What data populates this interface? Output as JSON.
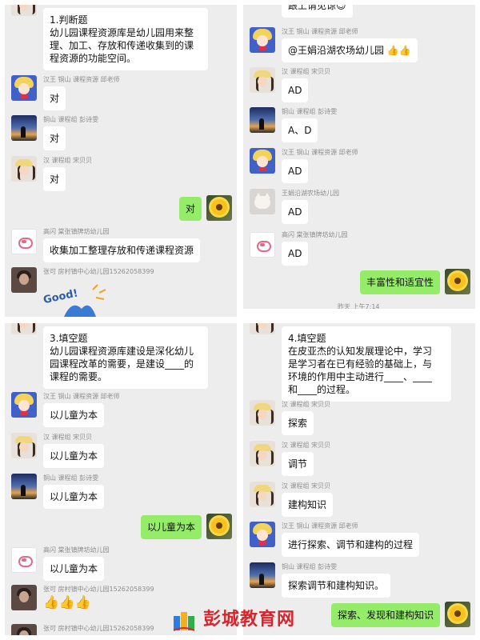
{
  "panel1": {
    "question": "1.判断题\n幼儿园课程资源库是幼儿园用来整\n理、加工、存放和传递收集到的课\n程资源的功能空间。",
    "messages": [
      {
        "sender": "汉王  铜山  课程资源  邱老师",
        "text": "对",
        "avatar": "sailor-avatar"
      },
      {
        "sender": "铜山  课程组  彭诗雯",
        "text": "对",
        "avatar": "sunset-avatar"
      },
      {
        "sender": "汉  课程组  宋贝贝",
        "text": "对",
        "avatar": "girl-avatar"
      },
      {
        "sender": "",
        "text": "对",
        "avatar": "sunflower-avatar",
        "self": true
      },
      {
        "sender": "高闪  棠张镇牌坊幼儿园",
        "text": "收集加工整理存放和传递课程资源",
        "avatar": "pig-avatar"
      },
      {
        "sender": "张可  房村镇中心幼儿园15262058399",
        "text": "",
        "avatar": "dark-avatar"
      }
    ],
    "sticker_text": "Good!"
  },
  "panel2": {
    "top_text": "跟上请见谅😉",
    "messages": [
      {
        "sender": "汉王  铜山  课程资源  邱老师",
        "text": "@王娟沿湖农场幼儿园 👍👍"
      },
      {
        "sender": "汉  课程组  宋贝贝",
        "text": "AD"
      },
      {
        "sender": "铜山  课程组  彭诗雯",
        "text": "A、D"
      },
      {
        "sender": "汉王  铜山  课程资源  邱老师",
        "text": "AD"
      },
      {
        "sender": "王娟沿湖农场幼儿园",
        "text": "AD"
      },
      {
        "sender": "高闪  棠张镇牌坊幼儿园",
        "text": "AD"
      },
      {
        "sender": "",
        "text": "丰富性和适宜性",
        "self": true
      }
    ],
    "timestamp": "昨天 上午7:14"
  },
  "panel3": {
    "question": "3.填空题\n幼儿园课程资源库建设是深化幼儿\n园课程改革的需要，是建设____的\n课程的需要。",
    "messages": [
      {
        "sender": "汉王  铜山  课程资源  邱老师",
        "text": "以儿童为本"
      },
      {
        "sender": "汉  课程组  宋贝贝",
        "text": "以儿童为本"
      },
      {
        "sender": "铜山  课程组  彭诗雯",
        "text": "以儿童为本"
      },
      {
        "sender": "",
        "text": "以儿童为本",
        "self": true
      },
      {
        "sender": "高闪  棠张镇牌坊幼儿园",
        "text": "以儿童为本"
      },
      {
        "sender": "张可  房村镇中心幼儿园15262058399",
        "text": "👍👍👍"
      },
      {
        "sender": "张可  房村镇中心幼儿园15262058399",
        "text": ""
      }
    ]
  },
  "panel4": {
    "question": "4.填空题\n在皮亚杰的认知发展理论中，学习\n是学习者在已有经验的基础上，与\n环境的作用中主动进行____、____\n和____的过程。",
    "messages": [
      {
        "sender": "汉  课程组  宋贝贝",
        "text": "探索"
      },
      {
        "sender": "汉  课程组  宋贝贝",
        "text": "调节"
      },
      {
        "sender": "汉  课程组  宋贝贝",
        "text": "建构知识"
      },
      {
        "sender": "汉王  铜山  课程资源  邱老师",
        "text": "进行探索、调节和建构的过程"
      },
      {
        "sender": "铜山  课程组  彭诗雯",
        "text": "探索调节和建构知识。"
      },
      {
        "sender": "",
        "text": "探索、发现和建构知识",
        "self": true
      }
    ]
  },
  "watermark": {
    "text": "彭城教育网"
  },
  "colors": {
    "self_bubble": "#95ec69",
    "other_bubble": "#ffffff",
    "chat_bg": "#ededed",
    "watermark_red": "#d7252e"
  }
}
